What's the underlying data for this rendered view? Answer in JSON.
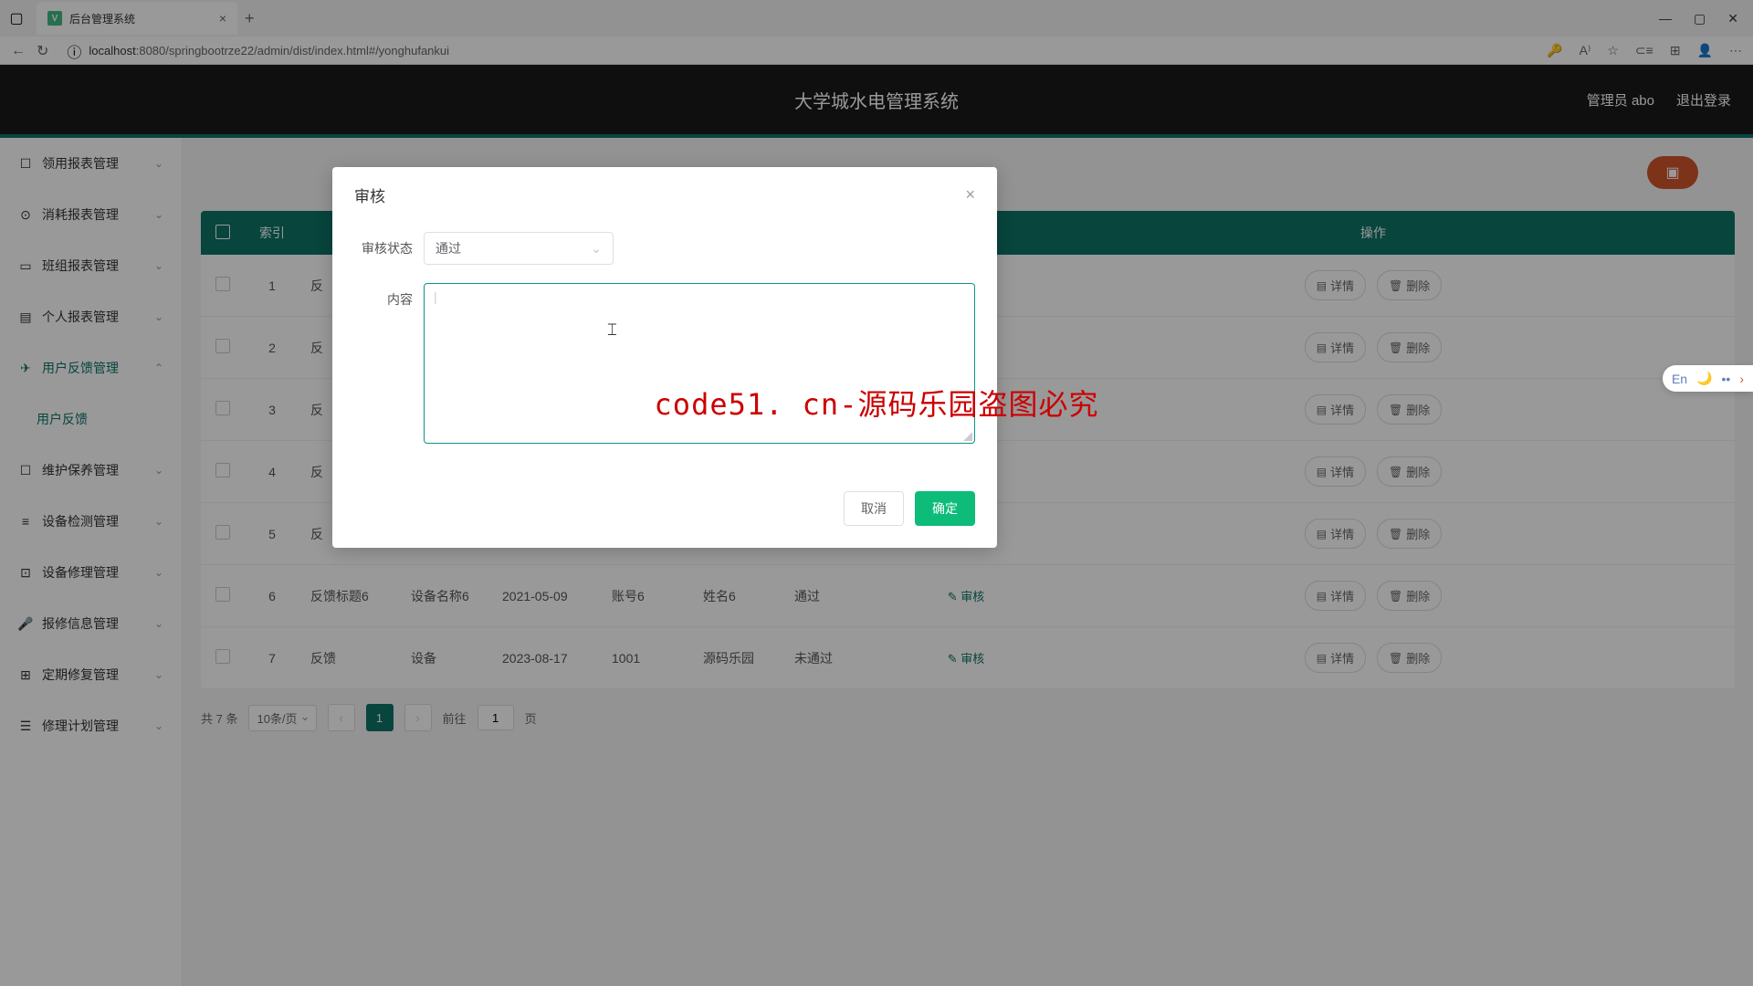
{
  "browser": {
    "tab_title": "后台管理系统",
    "url_host": "localhost",
    "url_port": ":8080",
    "url_path": "/springbootrze22/admin/dist/index.html#/yonghufankui"
  },
  "header": {
    "app_title": "大学城水电管理系统",
    "user_label": "管理员 abo",
    "logout": "退出登录"
  },
  "sidebar": {
    "items": [
      {
        "label": "领用报表管理",
        "icon": "☐"
      },
      {
        "label": "消耗报表管理",
        "icon": "⊙"
      },
      {
        "label": "班组报表管理",
        "icon": "▭"
      },
      {
        "label": "个人报表管理",
        "icon": "▤"
      },
      {
        "label": "用户反馈管理",
        "icon": "✈",
        "expanded": true
      },
      {
        "label": "用户反馈",
        "sub": true
      },
      {
        "label": "维护保养管理",
        "icon": "☐"
      },
      {
        "label": "设备检测管理",
        "icon": "≡"
      },
      {
        "label": "设备修理管理",
        "icon": "⊡"
      },
      {
        "label": "报修信息管理",
        "icon": "🎤"
      },
      {
        "label": "定期修复管理",
        "icon": "⊞"
      },
      {
        "label": "修理计划管理",
        "icon": "☰"
      }
    ]
  },
  "table": {
    "headers": {
      "index": "索引",
      "ops": "操作"
    },
    "rows": [
      {
        "idx": "1",
        "title": "反",
        "audit": "",
        "detail": "详情",
        "delete": "删除"
      },
      {
        "idx": "2",
        "title": "反",
        "audit": "",
        "detail": "详情",
        "delete": "删除"
      },
      {
        "idx": "3",
        "title": "反",
        "audit": "",
        "detail": "详情",
        "delete": "删除"
      },
      {
        "idx": "4",
        "title": "反",
        "audit": "",
        "detail": "详情",
        "delete": "删除"
      },
      {
        "idx": "5",
        "title": "反",
        "audit": "",
        "detail": "详情",
        "delete": "删除"
      },
      {
        "idx": "6",
        "title": "反馈标题6",
        "device": "设备名称6",
        "date": "2021-05-09",
        "account": "账号6",
        "name": "姓名6",
        "status": "通过",
        "audit": "审核",
        "detail": "详情",
        "delete": "删除"
      },
      {
        "idx": "7",
        "title": "反馈",
        "device": "设备",
        "date": "2023-08-17",
        "account": "1001",
        "name": "源码乐园",
        "status": "未通过",
        "audit": "审核",
        "detail": "详情",
        "delete": "删除"
      }
    ]
  },
  "pagination": {
    "total": "共 7 条",
    "page_size": "10条/页",
    "current": "1",
    "jump_prefix": "前往",
    "jump_val": "1",
    "jump_suffix": "页"
  },
  "modal": {
    "title": "审核",
    "status_label": "审核状态",
    "status_value": "通过",
    "content_label": "内容",
    "cancel": "取消",
    "confirm": "确定"
  },
  "watermark": "code51. cn-源码乐园盗图必究",
  "ime": {
    "lang": "En"
  }
}
